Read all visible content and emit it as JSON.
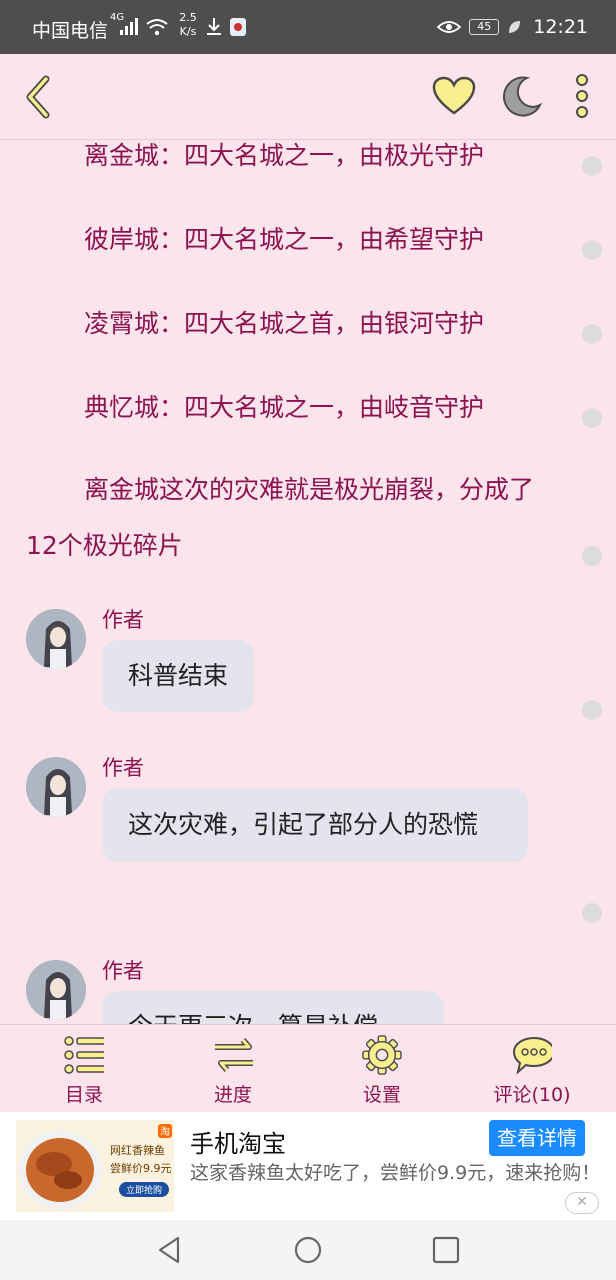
{
  "status_bar": {
    "carrier": "中国电信",
    "signal_label": "4G",
    "net_speed_value": "2.5",
    "net_speed_unit": "K/s",
    "battery": "45",
    "time": "12:21"
  },
  "toolbar": {
    "icons": [
      "back-icon",
      "heart-icon",
      "moon-icon",
      "more-icon"
    ],
    "colors": {
      "icon_fill": "#fbee8f",
      "icon_stroke": "#4a4a4a",
      "moon": "#9e9e9e"
    }
  },
  "content": {
    "paragraphs": [
      "离金城：四大名城之一，由极光守护",
      "彼岸城：四大名城之一，由希望守护",
      "凌霄城：四大名城之首，由银河守护",
      "典忆城：四大名城之一，由岐音守护",
      "离金城这次的灾难就是极光崩裂，分成了12个极光碎片"
    ],
    "messages": [
      {
        "author": "作者",
        "text": "科普结束"
      },
      {
        "author": "作者",
        "text": "这次灾难，引起了部分人的恐慌"
      },
      {
        "author": "作者",
        "text": "今天更三次，算是补偿"
      }
    ],
    "text_color": "#8b1450"
  },
  "bottom_nav": {
    "items": [
      {
        "label": "目录",
        "icon": "list-icon"
      },
      {
        "label": "进度",
        "icon": "swap-arrows-icon"
      },
      {
        "label": "设置",
        "icon": "gear-icon"
      },
      {
        "label": "评论(10)",
        "icon": "comment-icon"
      }
    ]
  },
  "ad": {
    "title": "手机淘宝",
    "button": "查看详情",
    "description": "这家香辣鱼太好吃了，尝鲜价9.9元，速来抢购！",
    "image_text": [
      "网红香辣鱼",
      "尝鲜价9.9元",
      "立即抢购"
    ],
    "badge": "淘",
    "close": "✕",
    "accent": "#1a8cff"
  }
}
